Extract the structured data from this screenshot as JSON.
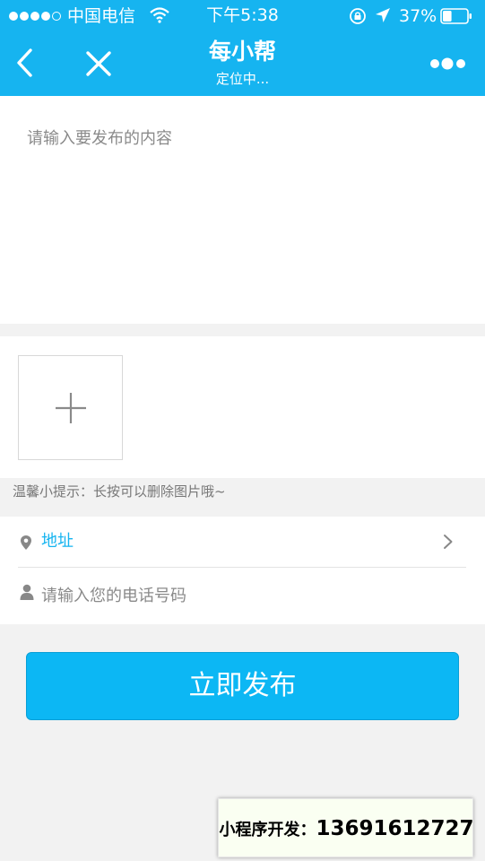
{
  "status_bar": {
    "carrier": "中国电信",
    "time": "下午5:38",
    "battery": "37%",
    "battery_level": 0.37
  },
  "nav": {
    "title": "每小帮",
    "subtitle": "定位中..."
  },
  "content": {
    "placeholder": "请输入要发布的内容"
  },
  "tip": "温馨小提示：长按可以删除图片哦~",
  "form": {
    "address_label": "地址",
    "phone_placeholder": "请输入您的电话号码"
  },
  "publish_button": "立即发布",
  "watermark": {
    "label": "小程序开发：",
    "number": "13691612727"
  },
  "colors": {
    "header": "#16b4f0",
    "button": "#0cb7f4",
    "accent_text": "#16b4f0"
  }
}
